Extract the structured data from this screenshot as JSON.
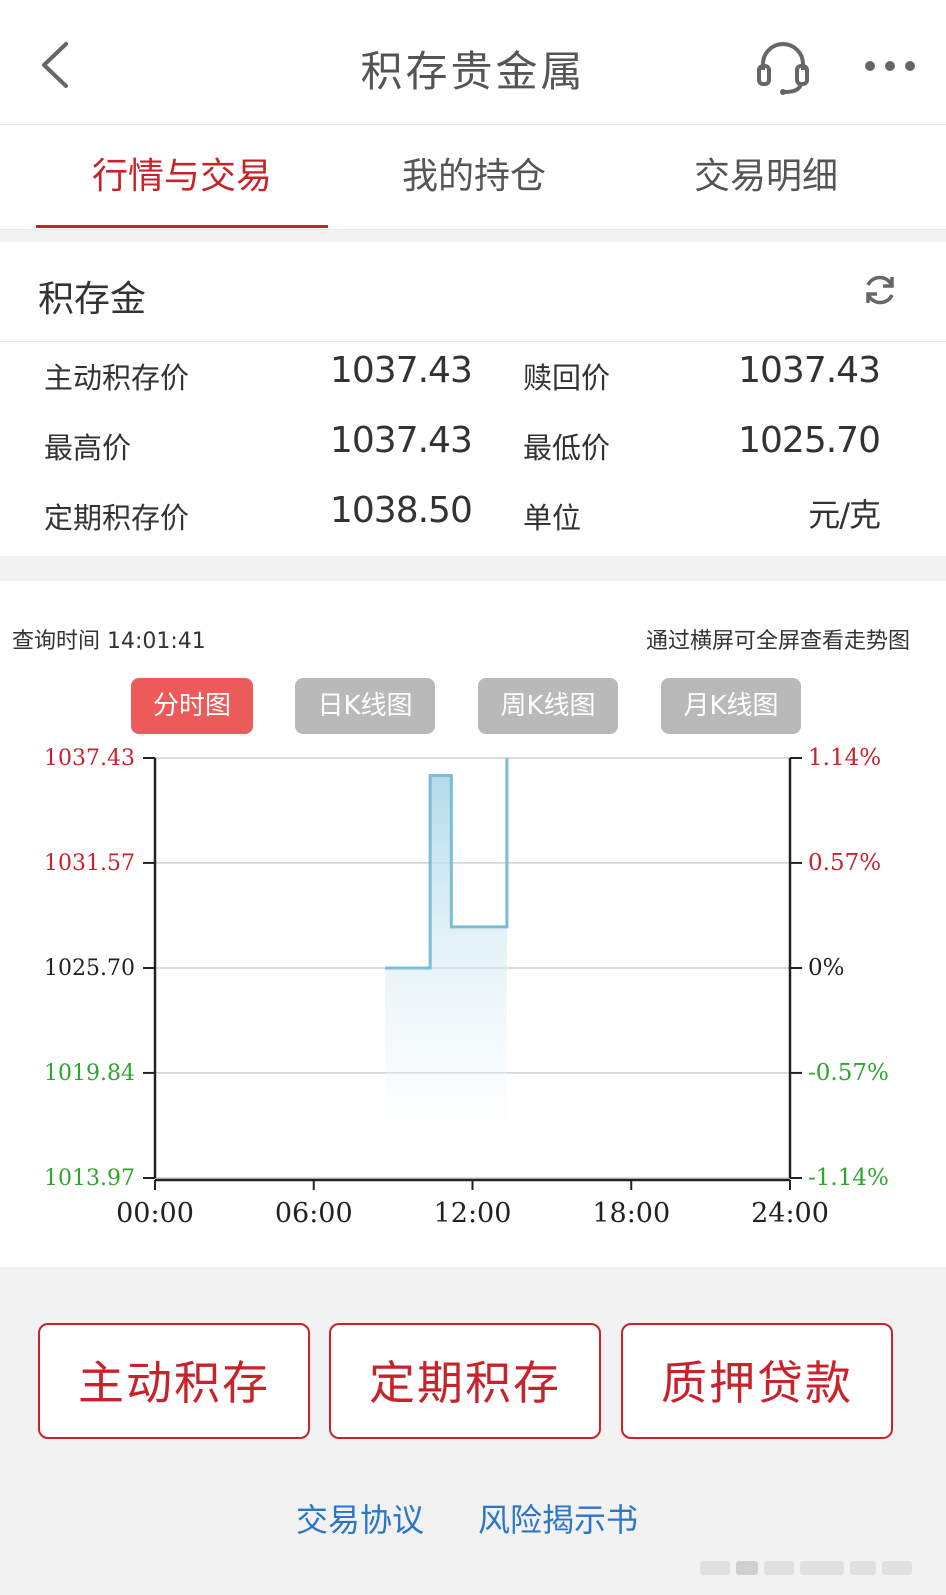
{
  "header": {
    "title": "积存贵金属",
    "back_icon": "chevron-left-icon",
    "service_icon": "headset-icon",
    "more_icon": "more-icon"
  },
  "tabs": [
    {
      "label": "行情与交易",
      "active": true
    },
    {
      "label": "我的持仓",
      "active": false
    },
    {
      "label": "交易明细",
      "active": false
    }
  ],
  "card": {
    "title": "积存金",
    "rows": [
      {
        "label_l": "主动积存价",
        "value_l": "1037.43",
        "label_r": "赎回价",
        "value_r": "1037.43"
      },
      {
        "label_l": "最高价",
        "value_l": "1037.43",
        "label_r": "最低价",
        "value_r": "1025.70"
      },
      {
        "label_l": "定期积存价",
        "value_l": "1038.50",
        "label_r": "单位",
        "value_r": "元/克"
      }
    ]
  },
  "query_time": "查询时间 14:01:41",
  "rotate_hint": "通过横屏可全屏查看走势图",
  "chart_tabs": [
    {
      "label": "分时图",
      "active": true
    },
    {
      "label": "日K线图",
      "active": false
    },
    {
      "label": "周K线图",
      "active": false
    },
    {
      "label": "月K线图",
      "active": false
    }
  ],
  "colors": {
    "accent": "#c8232b",
    "up": "#c8232b",
    "down": "#2ea62e",
    "line": "#7bbdd4",
    "link": "#2a76c8"
  },
  "chart_data": {
    "type": "area",
    "x_ticks": [
      "00:00",
      "06:00",
      "12:00",
      "18:00",
      "24:00"
    ],
    "xlim": [
      0,
      24
    ],
    "y_ticks": [
      {
        "value": 1037.43,
        "label": "1037.43",
        "pct": "1.14%",
        "tone": "up"
      },
      {
        "value": 1031.57,
        "label": "1031.57",
        "pct": "0.57%",
        "tone": "up"
      },
      {
        "value": 1025.7,
        "label": "1025.70",
        "pct": "0%",
        "tone": "neutral"
      },
      {
        "value": 1019.84,
        "label": "1019.84",
        "pct": "-0.57%",
        "tone": "down"
      },
      {
        "value": 1013.97,
        "label": "1013.97",
        "pct": "-1.14%",
        "tone": "down"
      }
    ],
    "ylim": [
      1013.97,
      1037.43
    ],
    "base_price": 1025.7,
    "series": [
      {
        "x": [
          8.7,
          10.4,
          10.4,
          11.2,
          11.2,
          13.3,
          13.3
        ],
        "y": [
          1025.7,
          1025.7,
          1036.45,
          1036.45,
          1028.0,
          1028.0,
          1037.43
        ]
      }
    ]
  },
  "actions": [
    "主动积存",
    "定期积存",
    "质押贷款"
  ],
  "links": [
    "交易协议",
    "风险揭示书"
  ]
}
